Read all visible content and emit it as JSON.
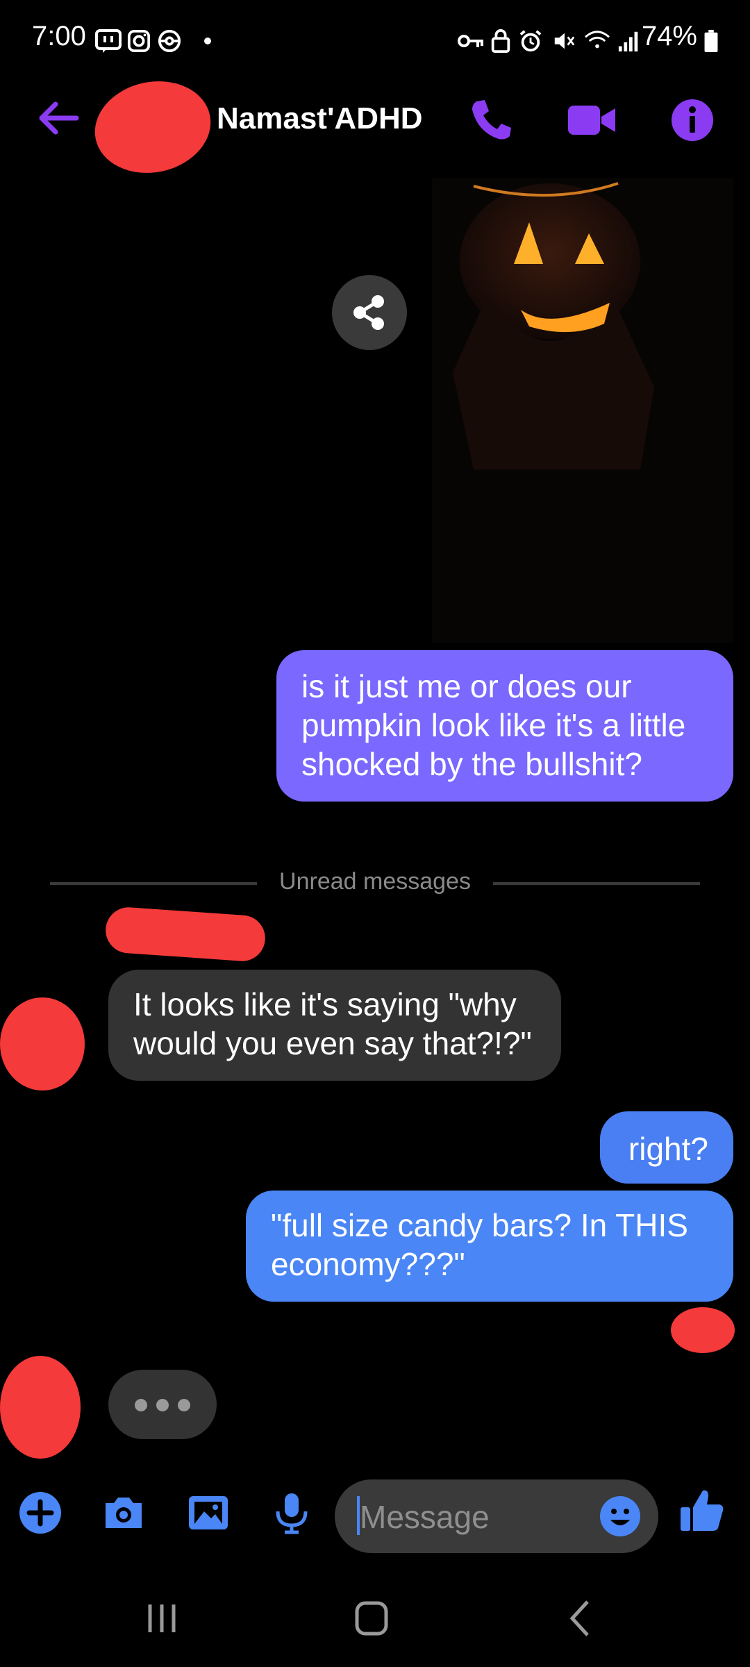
{
  "status_bar": {
    "time": "7:00",
    "battery": "74%"
  },
  "header": {
    "contact_name": "Namast'ADHD"
  },
  "messages": {
    "sent_1": "is it just me or does our pumpkin look like it's a little shocked by the bullshit?",
    "divider": "Unread messages",
    "received_1": "It looks like it's saying \"why would you even say that?!?\"",
    "sent_2": "right?",
    "sent_3": "\"full size candy bars?  In THIS economy???\""
  },
  "composer": {
    "placeholder": "Message"
  },
  "colors": {
    "accent_purple": "#8b3cf2",
    "accent_blue": "#4a86f5",
    "bubble_purple": "#7a68ff",
    "bubble_grey": "#333333",
    "redaction": "#f43a3a"
  }
}
